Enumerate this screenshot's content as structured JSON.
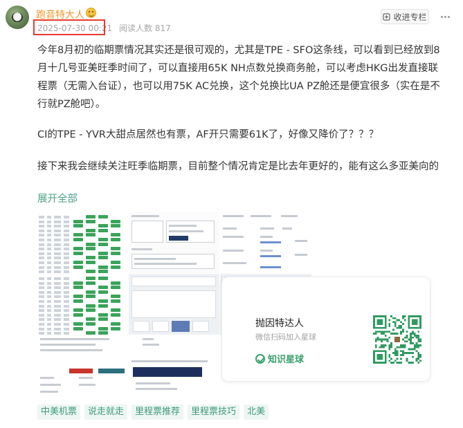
{
  "author": {
    "name": "跑音特大人"
  },
  "meta": {
    "timestamp": "2025-07-30 00:21",
    "reads_label": "阅读人数",
    "reads_count": "817"
  },
  "actions": {
    "favorite_label": "收进专栏"
  },
  "post": {
    "paragraphs": [
      "今年8月初的临期票情况其实还是很可观的，尤其是TPE - SFO这条线，可以看到已经放到8月十几号亚美旺季时间了，可以直接用65K NH点数兑换商务舱，可以考虑HKG出发直接联程票（无需入台证），也可以用75K AC兑换，这个兑换比UA PZ舱还是便宜很多（实在是不行就PZ舱吧）。",
      "CI的TPE - YVR大甜点居然也有票，AF开只需要61K了，好像又降价了？？？",
      "接下来我会继续关注旺季临期票，目前整个情况肯定是比去年更好的，能有这么多亚美向的"
    ],
    "expand_label": "展开全部"
  },
  "qr_card": {
    "title": "抛因特达人",
    "subtitle": "微信扫码加入星球",
    "brand": "知识星球"
  },
  "tags": [
    "中美机票",
    "说走就走",
    "里程票推荐",
    "里程票技巧",
    "北美"
  ],
  "colors": {
    "author": "#e99a2e",
    "accent_green": "#4aa383",
    "highlight_red": "#e63b2e",
    "tag_bg": "#eef6f3"
  }
}
